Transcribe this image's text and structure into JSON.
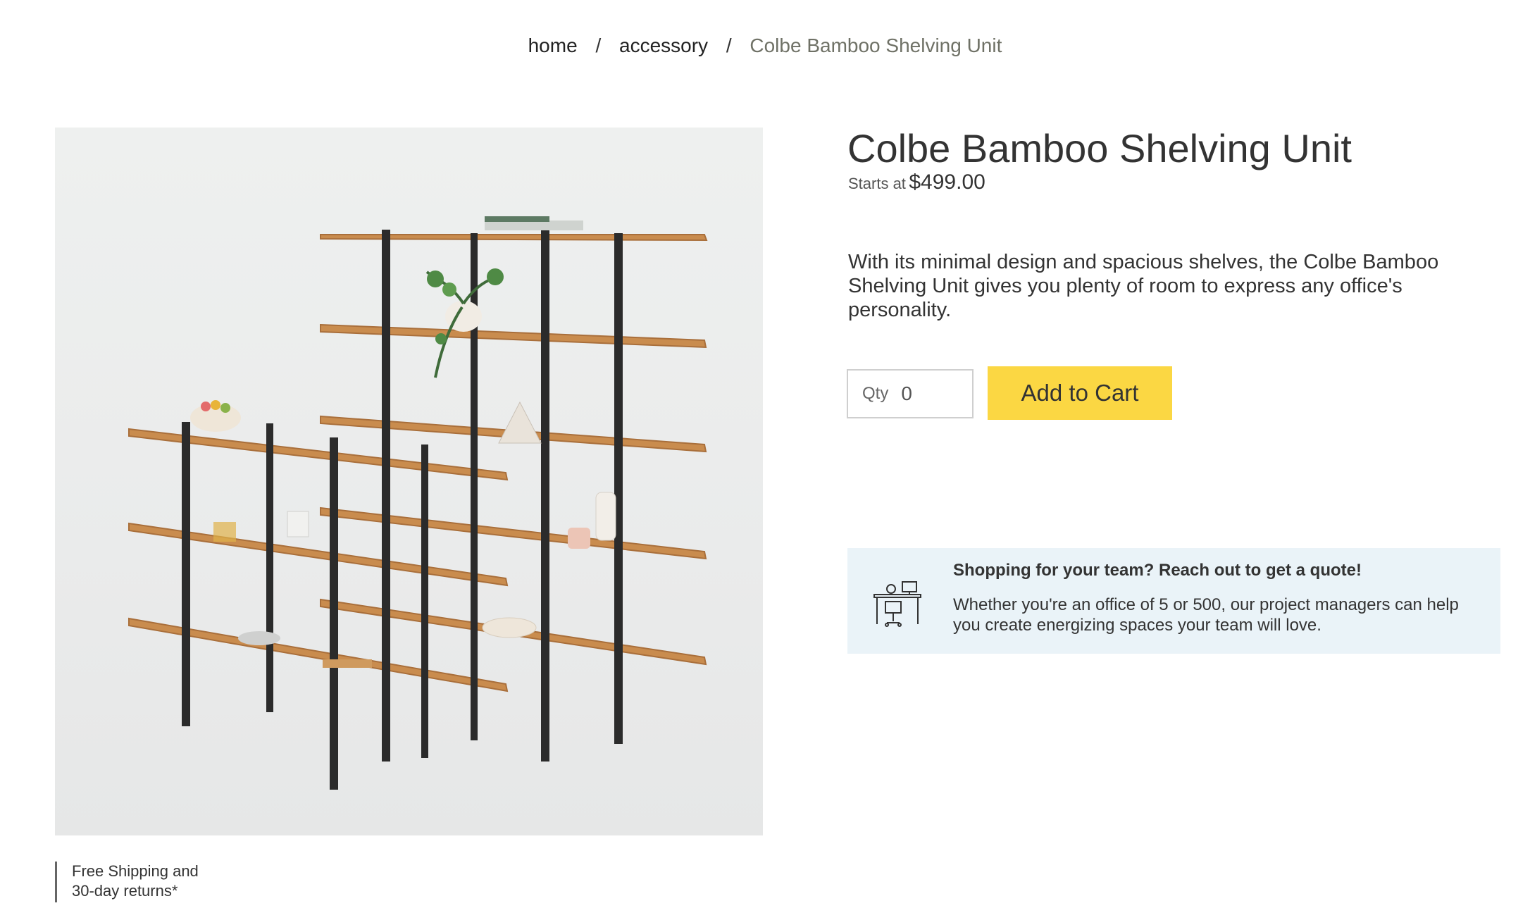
{
  "breadcrumb": {
    "items": [
      "home",
      "accessory",
      "Colbe Bamboo Shelving Unit"
    ],
    "separator": "/"
  },
  "product": {
    "title": "Colbe Bamboo Shelving Unit",
    "price_prefix": "Starts at",
    "price": "$499.00",
    "description": "With its minimal design and spacious shelves, the Colbe Bamboo Shelving Unit gives you plenty of room to express any office's personality.",
    "qty_label": "Qty",
    "qty_value": "0",
    "add_to_cart_label": "Add to Cart"
  },
  "shipping_note": {
    "line1": "Free Shipping and",
    "line2": "30-day returns*"
  },
  "quote": {
    "title": "Shopping for your team? Reach out to get a quote!",
    "text": "Whether you're an office of 5 or 500, our project managers can help you create energizing spaces your team will love.",
    "icon": "office-desk-icon"
  },
  "colors": {
    "accent_button": "#fbd743",
    "quote_background": "#eaf3f8",
    "breadcrumb_current": "#6f7166"
  }
}
